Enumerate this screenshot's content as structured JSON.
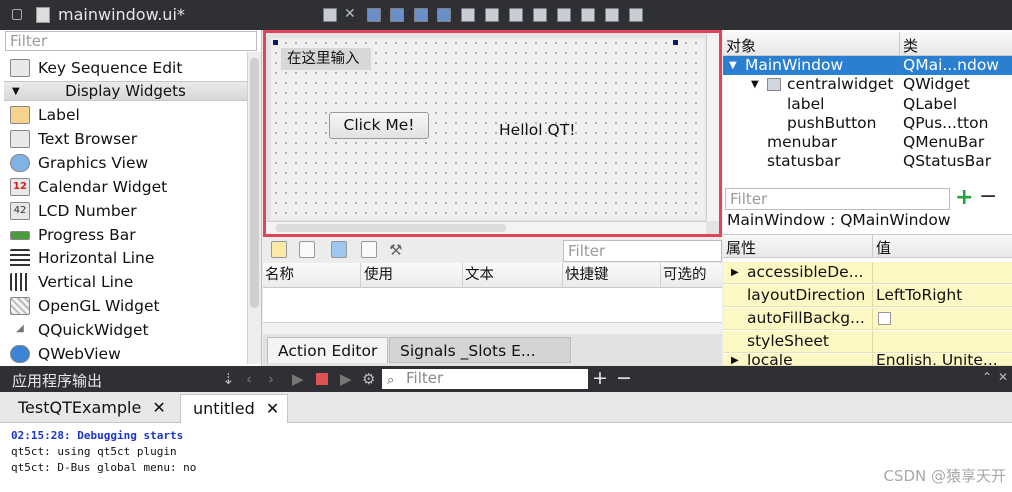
{
  "window": {
    "title": "mainwindow.ui*"
  },
  "widget_box": {
    "filter_placeholder": "Filter",
    "first_item": "Key Sequence Edit",
    "category": "Display Widgets",
    "items": [
      {
        "label": "Label",
        "icon": "label-icon"
      },
      {
        "label": "Text Browser",
        "icon": "text-browser-icon"
      },
      {
        "label": "Graphics View",
        "icon": "graphics-view-icon"
      },
      {
        "label": "Calendar Widget",
        "icon": "calendar-icon"
      },
      {
        "label": "LCD Number",
        "icon": "lcd-number-icon"
      },
      {
        "label": "Progress Bar",
        "icon": "progress-bar-icon"
      },
      {
        "label": "Horizontal Line",
        "icon": "horizontal-line-icon"
      },
      {
        "label": "Vertical Line",
        "icon": "vertical-line-icon"
      },
      {
        "label": "OpenGL Widget",
        "icon": "opengl-icon"
      },
      {
        "label": "QQuickWidget",
        "icon": "quick-widget-icon"
      },
      {
        "label": "QWebView",
        "icon": "web-view-icon"
      }
    ],
    "calendar_glyph": "12",
    "lcd_glyph": "42"
  },
  "form": {
    "menubar_placeholder": "在这里输入",
    "button_label": "Click Me!",
    "label_text": "Hellol QT!"
  },
  "action_editor": {
    "filter_placeholder": "Filter",
    "columns": [
      "名称",
      "使用",
      "文本",
      "快捷键",
      "可选的"
    ],
    "tabs": [
      "Action Editor",
      "Signals _Slots E..."
    ]
  },
  "object_inspector": {
    "col_object": "对象",
    "col_class": "类",
    "rows": [
      {
        "name": "MainWindow",
        "class": "QMai...ndow",
        "selected": true
      },
      {
        "name": "centralwidget",
        "class": "QWidget"
      },
      {
        "name": "label",
        "class": "QLabel"
      },
      {
        "name": "pushButton",
        "class": "QPus...tton"
      },
      {
        "name": "menubar",
        "class": "QMenuBar"
      },
      {
        "name": "statusbar",
        "class": "QStatusBar"
      }
    ]
  },
  "property_editor": {
    "filter_placeholder": "Filter",
    "class_title": "MainWindow : QMainWindow",
    "col_property": "属性",
    "col_value": "值",
    "rows": [
      {
        "name": "accessibleDe...",
        "value": ""
      },
      {
        "name": "layoutDirection",
        "value": "LeftToRight"
      },
      {
        "name": "autoFillBackg...",
        "value": ""
      },
      {
        "name": "styleSheet",
        "value": ""
      },
      {
        "name": "locale",
        "value": "English, Unite..."
      }
    ]
  },
  "output": {
    "title": "应用程序输出",
    "filter_placeholder": "Filter",
    "tabs": [
      "TestQTExample",
      "untitled"
    ],
    "lines": [
      "02:15:28: Debugging starts",
      "qt5ct: using qt5ct plugin",
      "qt5ct: D-Bus global menu: no"
    ],
    "watermark": "CSDN @猿享天开"
  },
  "colors": {
    "selection": "#2b7fd1",
    "form_highlight": "#e2435a",
    "property_row": "#fdf7c4",
    "debug_text": "#1a36c7"
  }
}
